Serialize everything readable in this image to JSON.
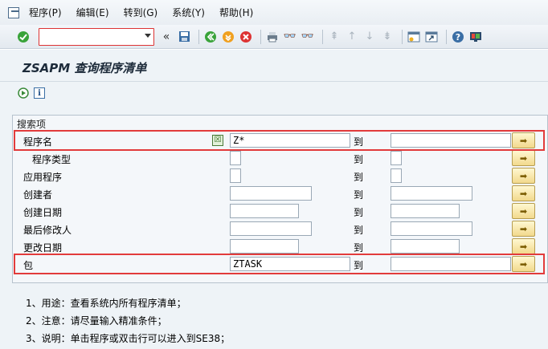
{
  "menubar": {
    "items": [
      {
        "label": "程序(P)"
      },
      {
        "label": "编辑(E)"
      },
      {
        "label": "转到(G)"
      },
      {
        "label": "系统(Y)"
      },
      {
        "label": "帮助(H)"
      }
    ]
  },
  "toolbar": {
    "command_field": {
      "value": "",
      "placeholder": ""
    }
  },
  "title": "ZSAPM 查询程序清单",
  "group": {
    "title": "搜索项",
    "to_label": "到",
    "rows": [
      {
        "label": "程序名",
        "from": "Z*",
        "to": ""
      },
      {
        "label": "程序类型",
        "from": "",
        "to": ""
      },
      {
        "label": "应用程序",
        "from": "",
        "to": ""
      },
      {
        "label": "创建者",
        "from": "",
        "to": ""
      },
      {
        "label": "创建日期",
        "from": "",
        "to": ""
      },
      {
        "label": "最后修改人",
        "from": "",
        "to": ""
      },
      {
        "label": "更改日期",
        "from": "",
        "to": ""
      },
      {
        "label": "包",
        "from": "ZTASK",
        "to": ""
      }
    ]
  },
  "notes": [
    "1、用途：查看系统内所有程序清单；",
    "2、注意：请尽量输入精准条件；",
    "3、说明：单击程序或双击行可以进入到SE38；"
  ],
  "colors": {
    "highlight": "#e23b3b",
    "accent_button": "#f2d98c",
    "background": "#eef3f7"
  }
}
